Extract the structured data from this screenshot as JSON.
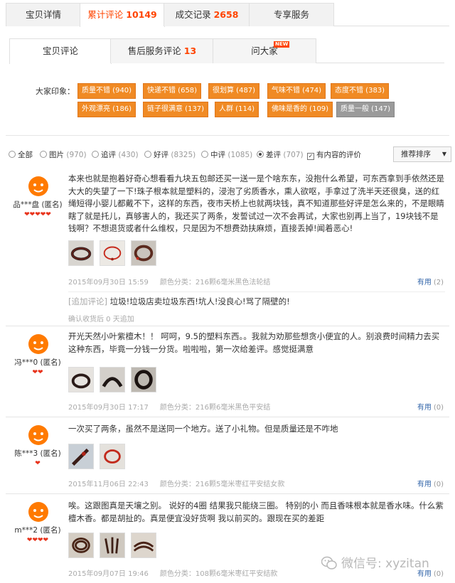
{
  "main_tabs": [
    {
      "label": "宝贝详情",
      "count": ""
    },
    {
      "label": "累计评论",
      "count": "10149"
    },
    {
      "label": "成交记录",
      "count": "2658"
    },
    {
      "label": "专享服务",
      "count": ""
    }
  ],
  "sub_tabs": [
    {
      "label": "宝贝评论",
      "count": ""
    },
    {
      "label": "售后服务评论",
      "count": "13"
    },
    {
      "label": "问大家",
      "count": "",
      "badge": "NEW"
    }
  ],
  "impressions": {
    "label": "大家印象：",
    "tags": [
      {
        "text": "质量不错 (940)",
        "type": "positive"
      },
      {
        "text": "快递不错 (658)",
        "type": "positive"
      },
      {
        "text": "很划算 (487)",
        "type": "positive"
      },
      {
        "text": "气味不错 (474)",
        "type": "positive"
      },
      {
        "text": "态度不错 (383)",
        "type": "positive"
      },
      {
        "text": "外观漂亮 (186)",
        "type": "positive"
      },
      {
        "text": "链子很满意 (137)",
        "type": "positive"
      },
      {
        "text": "人群 (114)",
        "type": "positive"
      },
      {
        "text": "佛味是香的 (109)",
        "type": "positive"
      },
      {
        "text": "质量一般 (147)",
        "type": "neutral"
      }
    ]
  },
  "filters": [
    {
      "label": "全部",
      "count": "",
      "kind": "radio"
    },
    {
      "label": "图片",
      "count": "(970)",
      "kind": "radio"
    },
    {
      "label": "追评",
      "count": "(430)",
      "kind": "radio"
    },
    {
      "label": "好评",
      "count": "(8325)",
      "kind": "radio"
    },
    {
      "label": "中评",
      "count": "(1085)",
      "kind": "radio"
    },
    {
      "label": "差评",
      "count": "(707)",
      "kind": "radio"
    },
    {
      "label": "有内容的评价",
      "count": "",
      "kind": "checkbox",
      "checked": true
    }
  ],
  "sort": {
    "label": "推荐排序",
    "arrow": "▼"
  },
  "reviews": [
    {
      "user": "品***盘 (匿名)",
      "hearts": "❤❤❤❤❤",
      "content": "本来也就是抱着好奇心想看看九块五包邮还买一送一是个啥东东，没抱什么希望，可东西拿到手依然还是大大的失望了一下!珠子根本就是塑料的，浸泡了劣质香水，熏人欲呕，手拿过了洗半天还很臭，送的红绳短得小婴儿都戴不下，这样的东西，夜市天桥上也就两块钱，真不知道那些好评是怎么来的，不是眼睛瞎了就是托儿，真够害人的，我还买了两条，发誓试过一次不会再试，大家也别再上当了，19块钱不是钱啊？不想退货或者什么维权，只是因为不想费劲扶麻烦，直接丢掉!闻着恶心!",
      "date": "2015年09月30日 15:59",
      "spec": "颜色分类：216颗6毫米黑色法轮结",
      "useful_label": "有用",
      "useful_count": "(2)",
      "append": {
        "label": "[追加评论]",
        "text": "垃圾!垃圾店卖垃圾东西!坑人!没良心!骂了隔壁的!",
        "meta": "确认收货后 0 天追加"
      }
    },
    {
      "user": "冯***0 (匿名)",
      "hearts": "❤❤",
      "content": "开光天然小叶紫檀木！！ 呵呵，9.5的塑料东西。。我就为劝那些想贪小便宜的人。别浪费时间精力去买这种东西，毕竟一分钱一分货。啦啦啦，第一次给差评。感觉挺满意",
      "date": "2015年09月30日 17:17",
      "spec": "颜色分类：216颗6毫米黑色平安结",
      "useful_label": "有用",
      "useful_count": "(0)"
    },
    {
      "user": "陈***3 (匿名)",
      "hearts": "❤",
      "content": "一次买了两条，虽然不是送同一个地方。送了小礼物。但是质量还是不咋地",
      "date": "2015年11月06日 22:43",
      "spec": "颜色分类：216颗5毫米枣红平安结女款",
      "useful_label": "有用",
      "useful_count": "(0)"
    },
    {
      "user": "m***2 (匿名)",
      "hearts": "❤❤❤❤",
      "content": "唉。这跟图真是天壤之别。 说好的4圈 结果我只能绕三圈。 特别的小 而且香味根本就是香水味。什么紫檀木香。都是胡扯的。真是便宜没好货啊 我以前买的。跟现在买的差距",
      "date": "2015年09月07日 19:46",
      "spec": "颜色分类：108颗6毫米枣红平安结款",
      "useful_label": "有用",
      "useful_count": "(0)"
    }
  ],
  "watermark": "微信号: xyzitan",
  "colors": {
    "accent": "#ff4400",
    "tag_orange": "#f08a24",
    "tag_grey": "#9a9a9a",
    "link": "#3366aa",
    "heart": "#e8331c"
  }
}
